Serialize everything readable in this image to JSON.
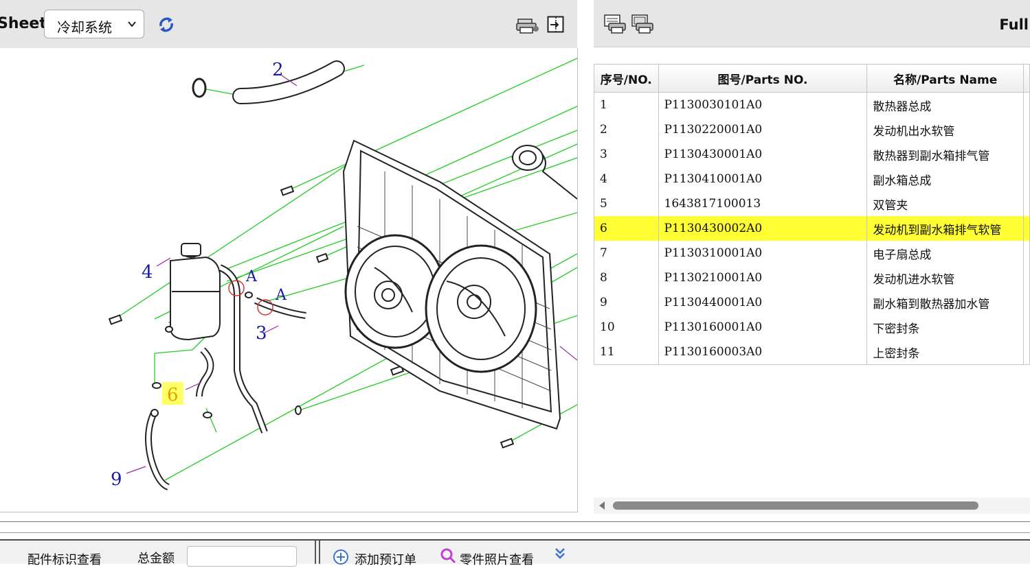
{
  "left_toolbar": {
    "sheet_label": "Sheet",
    "sheet_value": "冷却系统",
    "icons": [
      "refresh-icon",
      "print-icon",
      "exit-icon"
    ]
  },
  "diagram": {
    "callouts": [
      "2",
      "4",
      "A",
      "A",
      "3",
      "6",
      "9"
    ],
    "highlight_color": "#ffff66",
    "leader_color": "#22cc22",
    "callout_color": "#1a1aa8"
  },
  "right_toolbar": {
    "full_label": "Full",
    "icons": [
      "print-list-icon",
      "print-all-icon"
    ]
  },
  "parts_table": {
    "headers": [
      "序号/NO.",
      "图号/Parts NO.",
      "名称/Parts Name"
    ],
    "rows": [
      {
        "no": "1",
        "part_no": "P1130030101A0",
        "name": "散热器总成"
      },
      {
        "no": "2",
        "part_no": "P1130220001A0",
        "name": "发动机出水软管"
      },
      {
        "no": "3",
        "part_no": "P1130430001A0",
        "name": "散热器到副水箱排气管"
      },
      {
        "no": "4",
        "part_no": "P1130410001A0",
        "name": "副水箱总成"
      },
      {
        "no": "5",
        "part_no": "1643817100013",
        "name": "双管夹"
      },
      {
        "no": "6",
        "part_no": "P1130430002A0",
        "name": "发动机到副水箱排气软管"
      },
      {
        "no": "7",
        "part_no": "P1130310001A0",
        "name": "电子扇总成"
      },
      {
        "no": "8",
        "part_no": "P1130210001A0",
        "name": "发动机进水软管"
      },
      {
        "no": "9",
        "part_no": "P1130440001A0",
        "name": "副水箱到散热器加水管"
      },
      {
        "no": "10",
        "part_no": "P1130160001A0",
        "name": "下密封条"
      },
      {
        "no": "11",
        "part_no": "P1130160003A0",
        "name": "上密封条"
      }
    ],
    "selected_index": 5,
    "selected_color": "#ffff33"
  },
  "bottom_bar": {
    "tag_view": "配件标识查看",
    "total_label": "总金额",
    "total_value": "",
    "add_order": "添加预订单",
    "photo_view": "零件照片查看"
  }
}
